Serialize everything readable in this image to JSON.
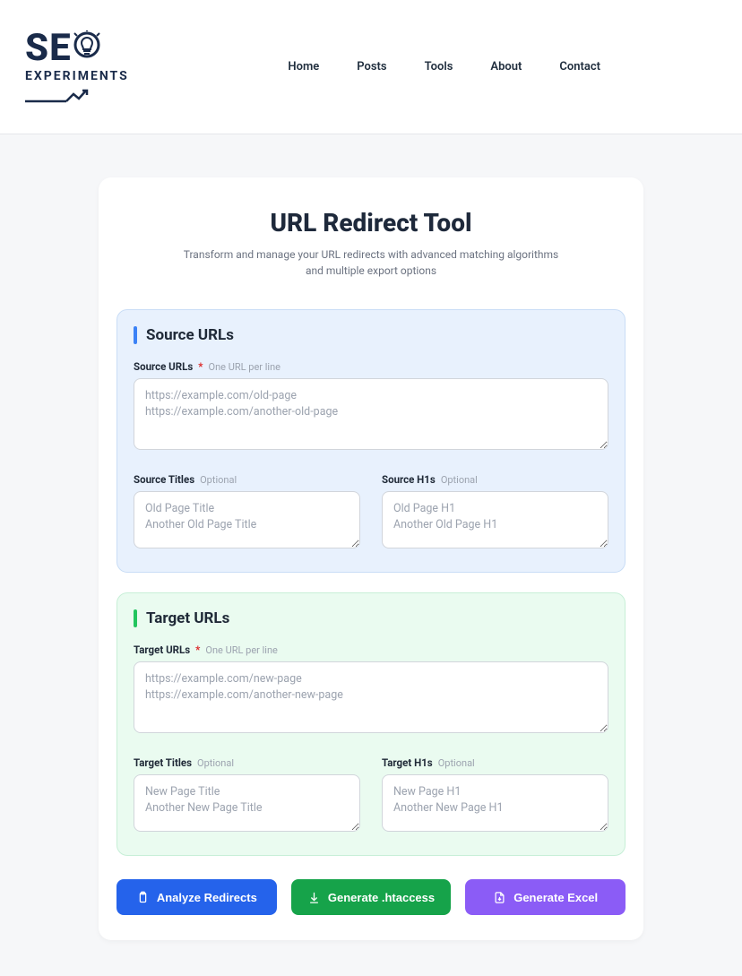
{
  "brand": {
    "word1": "SE",
    "word2": "EXPERIMENTS"
  },
  "nav": {
    "home": "Home",
    "posts": "Posts",
    "tools": "Tools",
    "about": "About",
    "contact": "Contact"
  },
  "page": {
    "title": "URL Redirect Tool",
    "subtitle": "Transform and manage your URL redirects with advanced matching algorithms and multiple export options"
  },
  "source": {
    "heading": "Source URLs",
    "urls_label": "Source URLs",
    "urls_hint": "One URL per line",
    "urls_placeholder": "https://example.com/old-page\nhttps://example.com/another-old-page",
    "titles_label": "Source Titles",
    "optional": "Optional",
    "titles_placeholder": "Old Page Title\nAnother Old Page Title",
    "h1s_label": "Source H1s",
    "h1s_placeholder": "Old Page H1\nAnother Old Page H1"
  },
  "target": {
    "heading": "Target URLs",
    "urls_label": "Target URLs",
    "urls_hint": "One URL per line",
    "urls_placeholder": "https://example.com/new-page\nhttps://example.com/another-new-page",
    "titles_label": "Target Titles",
    "optional": "Optional",
    "titles_placeholder": "New Page Title\nAnother New Page Title",
    "h1s_label": "Target H1s",
    "h1s_placeholder": "New Page H1\nAnother New Page H1"
  },
  "buttons": {
    "analyze": "Analyze Redirects",
    "htaccess": "Generate .htaccess",
    "excel": "Generate Excel"
  }
}
